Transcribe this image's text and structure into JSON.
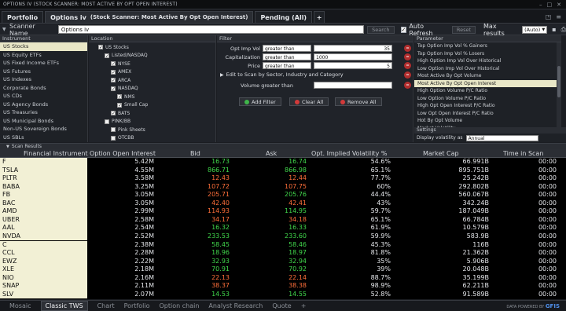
{
  "window": {
    "title": "OPTIONS IV   (STOCK SCANNER: MOST ACTIVE BY OPT OPEN INTEREST)"
  },
  "tabs": [
    {
      "label": "Portfolio",
      "sub": ""
    },
    {
      "label": "Options iv",
      "sub": "(Stock Scanner: Most Active By Opt Open Interest)"
    },
    {
      "label": "Pending (All)",
      "sub": ""
    },
    {
      "label": "+",
      "sub": ""
    }
  ],
  "scanner": {
    "name_label": "Scanner Name",
    "name_value": "Options iv",
    "search_label": "Search",
    "reset_label": "Reset",
    "auto_refresh_label": "Auto Refresh",
    "auto_refresh_checked": true,
    "max_results_label": "Max results",
    "max_results_value": "(Auto)"
  },
  "instrument": {
    "header": "Instrument",
    "items": [
      "US Stocks",
      "US Equity ETFs",
      "US Fixed Income ETFs",
      "US Futures",
      "US Indexes",
      "Corporate Bonds",
      "US CDs",
      "US Agency Bonds",
      "US Treasuries",
      "US Municipal Bonds",
      "Non-US Sovereign Bonds",
      "US SBLs",
      "Mutual Funds"
    ],
    "selected": 0
  },
  "location": {
    "header": "Location",
    "nodes": [
      "US Stocks",
      "Listed/NASDAQ",
      "NYSE",
      "AMEX",
      "ARCA",
      "NASDAQ",
      "NMS",
      "Small Cap",
      "BATS",
      "PINK/BB",
      "Pink Sheets",
      "OTCBB"
    ]
  },
  "filter": {
    "header": "Filter",
    "rows": [
      {
        "label": "Opt Imp Vol",
        "op": "greater than",
        "value": "35"
      },
      {
        "label": "Capitalization",
        "op": "greater than",
        "value": "1000"
      },
      {
        "label": "Price",
        "op": "greater than",
        "value": "5"
      }
    ],
    "edit_label": "Edit to Scan by Sector, Industry and Category",
    "volume_label": "Volume greater than",
    "volume_value": "",
    "add_filter": "Add Filter",
    "clear_all": "Clear All",
    "remove_all": "Remove All"
  },
  "parameter": {
    "header": "Parameter",
    "items": [
      "Top Option Imp Vol % Gainers",
      "Top Option Imp Vol % Losers",
      "High Option Imp Vol Over Historical",
      "Low Option Imp Vol Over Historical",
      "Most Active By Opt Volume",
      "Most Active By Opt Open Interest",
      "High Option Volume P/C Ratio",
      "Low Option Volume P/C Ratio",
      "High Opt Open Interest P/C Ratio",
      "Low Opt Open Interest P/C Ratio",
      "Hot By Opt Volume",
      "Market Volatility"
    ],
    "selected": 5
  },
  "settings": {
    "header": "Settings",
    "display_label": "Display volatility as",
    "display_value": "Annual"
  },
  "results": {
    "header": "Scan Results",
    "columns": [
      "Financial Instrument",
      "Option Open Interest",
      "Bid",
      "Ask",
      "Opt. Implied Volatility %",
      "Market Cap",
      "Time in Scan"
    ],
    "rows": [
      {
        "sym": "F",
        "oi": "5.42M",
        "bid": "16.73",
        "ask": "16.74",
        "iv": "54.6%",
        "cap": "66.991B",
        "t": "00:00",
        "d": "up"
      },
      {
        "sym": "TSLA",
        "oi": "4.55M",
        "bid": "866.71",
        "ask": "866.98",
        "iv": "65.1%",
        "cap": "895.751B",
        "t": "00:00",
        "d": "up"
      },
      {
        "sym": "PLTR",
        "oi": "3.58M",
        "bid": "12.43",
        "ask": "12.44",
        "iv": "77.7%",
        "cap": "25.242B",
        "t": "00:00",
        "d": "dn"
      },
      {
        "sym": "BABA",
        "oi": "3.25M",
        "bid": "107.72",
        "ask": "107.75",
        "iv": "60%",
        "cap": "292.802B",
        "t": "00:00",
        "d": "dn"
      },
      {
        "sym": "FB",
        "oi": "3.05M",
        "bid": "205.71",
        "ask": "205.76",
        "iv": "44.4%",
        "cap": "560.067B",
        "t": "00:00",
        "d": "mix"
      },
      {
        "sym": "BAC",
        "oi": "3.05M",
        "bid": "42.40",
        "ask": "42.41",
        "iv": "43%",
        "cap": "342.24B",
        "t": "00:00",
        "d": "dn"
      },
      {
        "sym": "AMD",
        "oi": "2.99M",
        "bid": "114.93",
        "ask": "114.95",
        "iv": "59.7%",
        "cap": "187.049B",
        "t": "00:00",
        "d": "mix"
      },
      {
        "sym": "UBER",
        "oi": "2.58M",
        "bid": "34.17",
        "ask": "34.18",
        "iv": "65.1%",
        "cap": "66.784B",
        "t": "00:00",
        "d": "dn"
      },
      {
        "sym": "AAL",
        "oi": "2.54M",
        "bid": "16.32",
        "ask": "16.33",
        "iv": "61.9%",
        "cap": "10.579B",
        "t": "00:00",
        "d": "up"
      },
      {
        "sym": "NVDA",
        "oi": "2.52M",
        "bid": "233.53",
        "ask": "233.60",
        "iv": "59.9%",
        "cap": "583.9B",
        "t": "00:00",
        "d": "up"
      },
      {
        "sym": "C",
        "oi": "2.38M",
        "bid": "58.45",
        "ask": "58.46",
        "iv": "45.3%",
        "cap": "116B",
        "t": "00:00",
        "d": "up"
      },
      {
        "sym": "CCL",
        "oi": "2.28M",
        "bid": "18.96",
        "ask": "18.97",
        "iv": "81.8%",
        "cap": "21.362B",
        "t": "00:00",
        "d": "up"
      },
      {
        "sym": "EWZ",
        "oi": "2.22M",
        "bid": "32.93",
        "ask": "32.94",
        "iv": "35%",
        "cap": "5.906B",
        "t": "00:00",
        "d": "up"
      },
      {
        "sym": "XLE",
        "oi": "2.18M",
        "bid": "70.91",
        "ask": "70.92",
        "iv": "39%",
        "cap": "20.048B",
        "t": "00:00",
        "d": "up"
      },
      {
        "sym": "NIO",
        "oi": "2.16M",
        "bid": "22.13",
        "ask": "22.14",
        "iv": "88.7%",
        "cap": "35.199B",
        "t": "00:00",
        "d": "dn"
      },
      {
        "sym": "SNAP",
        "oi": "2.11M",
        "bid": "38.37",
        "ask": "38.38",
        "iv": "98.9%",
        "cap": "62.211B",
        "t": "00:00",
        "d": "dn"
      },
      {
        "sym": "SLV",
        "oi": "2.07M",
        "bid": "14.53",
        "ask": "14.55",
        "iv": "52.8%",
        "cap": "91.589B",
        "t": "00:00",
        "d": "up"
      }
    ]
  },
  "bottom_tabs": [
    "Mosaic",
    "Classic TWS",
    "Chart",
    "Portfolio",
    "Option chain",
    "Analyst Research",
    "Quote",
    "+"
  ],
  "bottom_active": 1,
  "powered": "DATA POWERED BY",
  "powered_brand": "GFIS",
  "colors": {
    "up": "#41d84c",
    "down": "#ff6f3a",
    "selected_bg": "#e9e7c7",
    "symbol_bg": "#f2f0d5"
  }
}
